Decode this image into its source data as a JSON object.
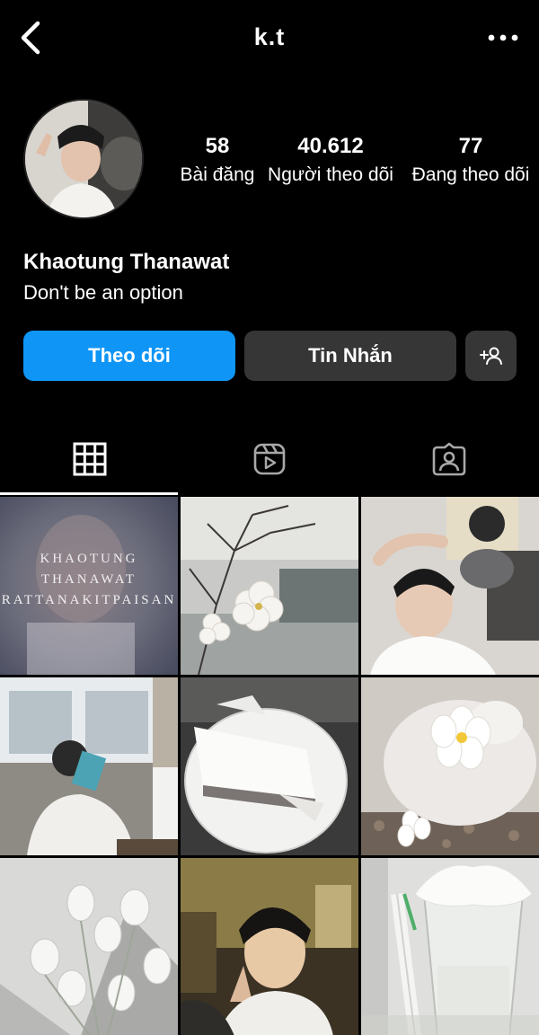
{
  "header": {
    "title": "k.t",
    "back_icon": "chevron-left-icon",
    "more_icon": "more-horizontal-icon"
  },
  "profile": {
    "avatar": "avatar",
    "stats": [
      {
        "value": "58",
        "label": "Bài đăng"
      },
      {
        "value": "40.612",
        "label": "Người theo dõi"
      },
      {
        "value": "77",
        "label": "Đang theo dõi"
      }
    ],
    "name": "Khaotung Thanawat",
    "bio": "Don't be an option"
  },
  "actions": {
    "follow_label": "Theo dõi",
    "message_label": "Tin Nhắn",
    "follow_color": "#0f95f6",
    "secondary_color": "#363636"
  },
  "tabs": [
    {
      "icon": "grid-icon",
      "active": true
    },
    {
      "icon": "reels-icon",
      "active": false
    },
    {
      "icon": "tagged-icon",
      "active": false
    }
  ],
  "grid": {
    "cover_lines": [
      "KHAOTUNG",
      "THANAWAT",
      "RATTANAKITPAISAN"
    ]
  }
}
